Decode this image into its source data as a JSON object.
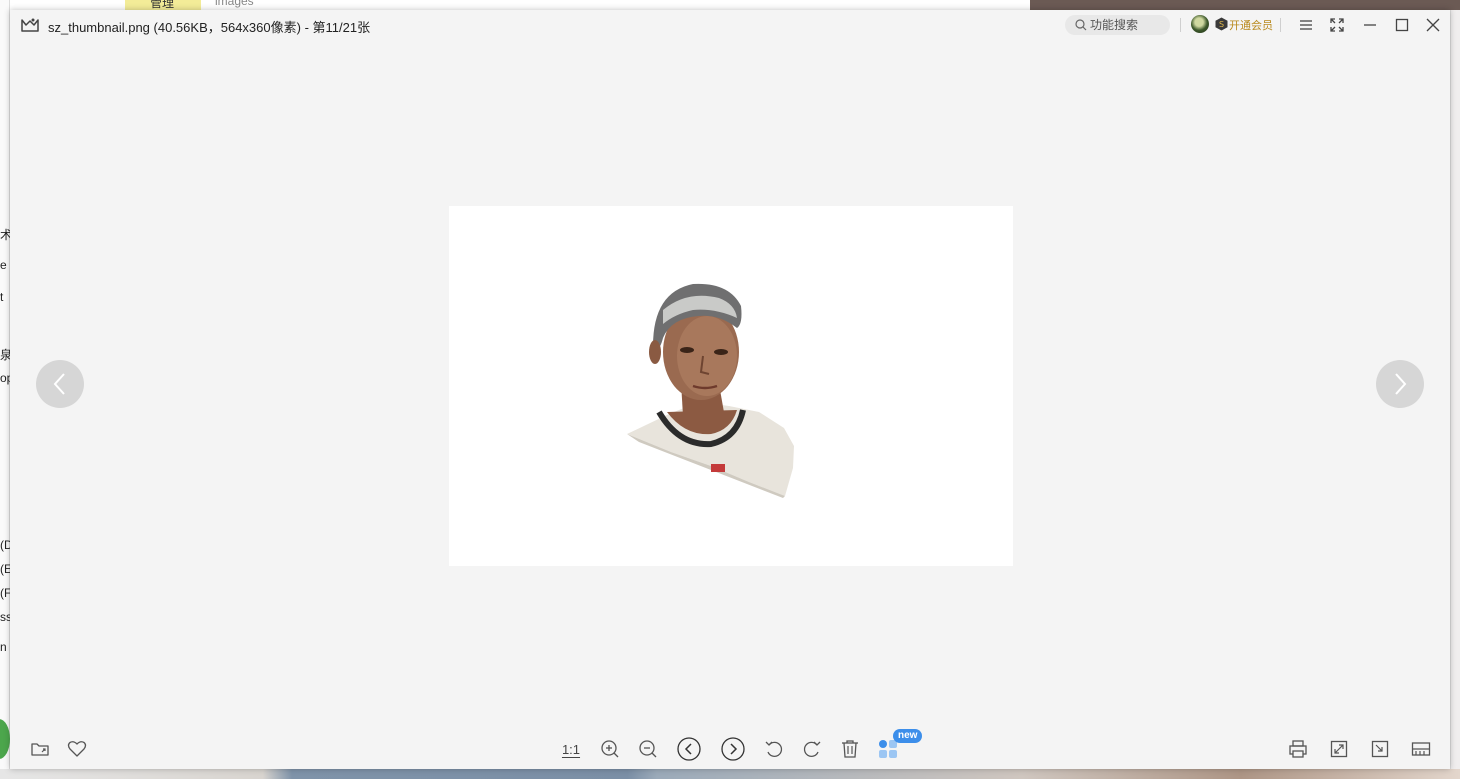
{
  "background": {
    "top_tab_label": "管理",
    "top_folder_label": "images",
    "left_fragments": [
      "术",
      "e",
      "t",
      "泉",
      "op",
      "(D",
      "(E",
      "(F",
      "ss",
      "n"
    ]
  },
  "titlebar": {
    "filename": "sz_thumbnail.png",
    "info": "(40.56KB，564x360像素)",
    "position": "- 第11/21张",
    "search_placeholder": "功能搜索",
    "vip_label": "开通会员"
  },
  "toolbar": {
    "actual_size_label": "1:1",
    "new_badge": "new"
  },
  "colors": {
    "window_bg": "#f4f4f4",
    "accent": "#3c8eea",
    "vip_gold": "#b98a1e"
  },
  "icons": [
    "image-icon",
    "search-icon",
    "avatar",
    "vip-icon",
    "menu-icon",
    "fullscreen-icon",
    "minimize-icon",
    "maximize-icon",
    "close-icon",
    "prev-arrow-icon",
    "next-arrow-icon",
    "open-folder-icon",
    "heart-icon",
    "zoom-in-icon",
    "zoom-out-icon",
    "prev-circle-icon",
    "next-circle-icon",
    "rotate-left-icon",
    "rotate-right-icon",
    "trash-icon",
    "apps-icon",
    "print-icon",
    "expand-icon",
    "fit-window-icon",
    "filmstrip-icon"
  ]
}
